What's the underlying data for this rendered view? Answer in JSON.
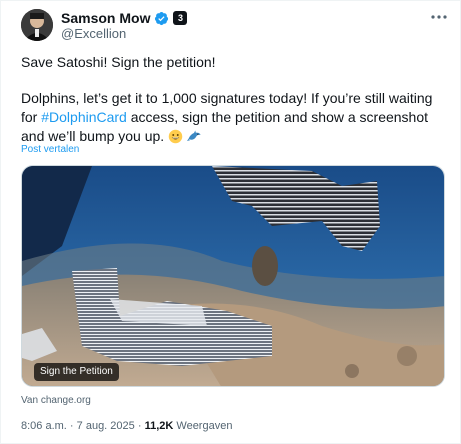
{
  "author": {
    "display_name": "Samson Mow",
    "handle": "@Excellion",
    "affiliate_badge": "3",
    "verified_icon": "verified-badge-icon",
    "accent_color": "#1d9bf0"
  },
  "tweet": {
    "line1": "Save Satoshi! Sign the petition!",
    "line2_pre": "Dolphins, let’s get it to 1,000 signatures today! If you’re still waiting for",
    "hashtag": "#DolphinCard",
    "line2_post": " access, sign the petition and show a screenshot and we’ll bump you up.",
    "emojis": [
      "grinning-face-icon",
      "dolphin-icon"
    ],
    "translate_label": "Post vertalen"
  },
  "card": {
    "label": "Sign the Petition",
    "source": "Van change.org",
    "image_description_icon": "statue-photo"
  },
  "meta": {
    "time": "8:06 a.m.",
    "separator": "·",
    "date": "7 aug. 2025",
    "views_count": "11,2K",
    "views_label": "Weergaven"
  }
}
